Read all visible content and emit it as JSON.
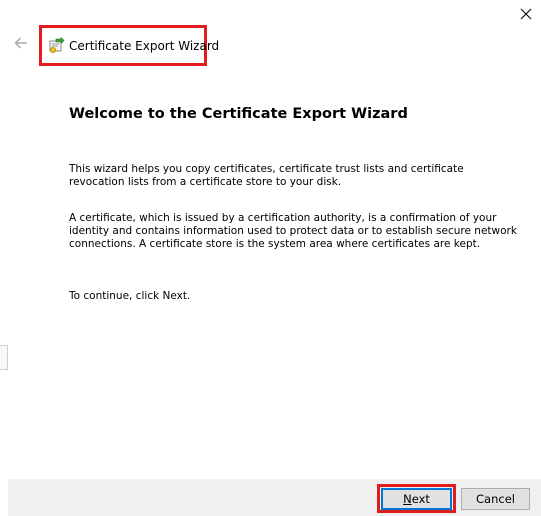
{
  "window": {
    "title": "Certificate Export Wizard"
  },
  "icons": {
    "close": "close-icon",
    "back": "back-arrow-icon",
    "wizard": "certificate-wizard-icon"
  },
  "content": {
    "heading": "Welcome to the Certificate Export Wizard",
    "paragraph1": "This wizard helps you copy certificates, certificate trust lists and certificate revocation lists from a certificate store to your disk.",
    "paragraph2": "A certificate, which is issued by a certification authority, is a confirmation of your identity and contains information used to protect data or to establish secure network connections. A certificate store is the system area where certificates are kept.",
    "paragraph3": "To continue, click Next."
  },
  "footer": {
    "next_label": "Next",
    "cancel_label": "Cancel"
  },
  "colors": {
    "highlight": "#e01c1c",
    "footer_bg": "#f0f0f0",
    "default_button_border": "#0078d7"
  }
}
